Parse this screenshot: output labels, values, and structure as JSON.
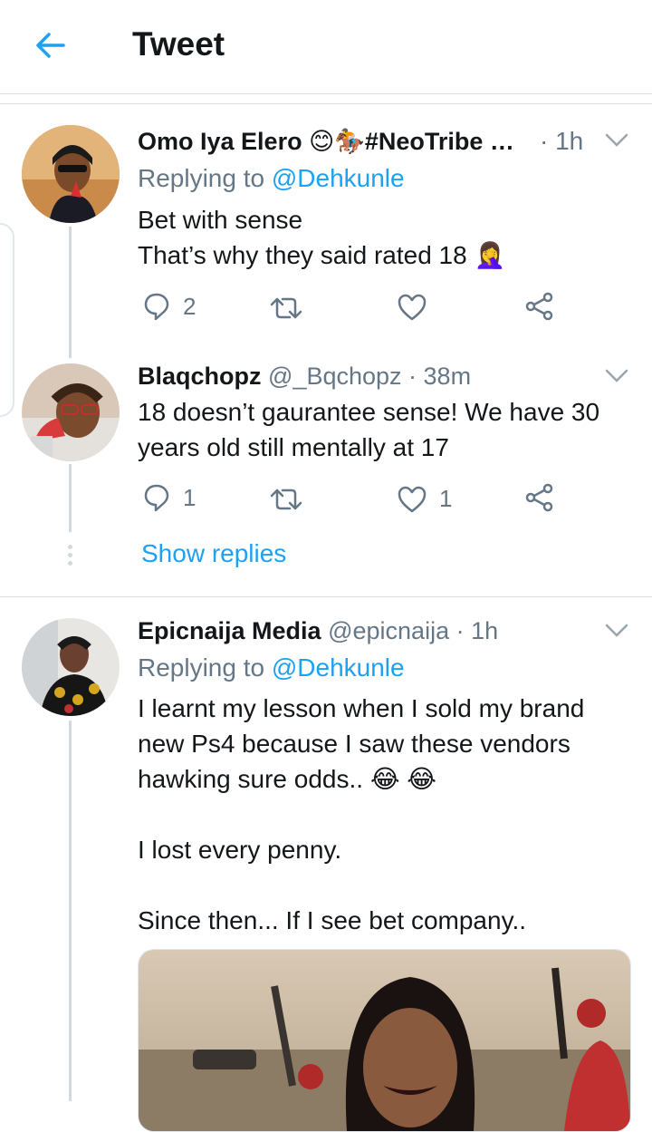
{
  "header": {
    "title": "Tweet"
  },
  "tweets": [
    {
      "name": "Omo Iya Elero 😊🏇#NeoTribe …",
      "handle": "",
      "time": "· 1h",
      "reply_prefix": "Replying to ",
      "reply_handle": "@Dehkunle",
      "text_lines": [
        "Bet with sense",
        "That’s why they said rated 18 🤦‍♀️"
      ],
      "reply_count": "2",
      "retweet_count": "",
      "like_count": ""
    },
    {
      "name": "Blaqchopz",
      "handle": "@_Bqchopz",
      "time": "· 38m",
      "text_lines": [
        "18 doesn’t gaurantee sense! We have 30",
        "years old still mentally at 17"
      ],
      "reply_count": "1",
      "retweet_count": "",
      "like_count": "1"
    },
    {
      "name": "Epicnaija Media",
      "handle": "@epicnaija",
      "time": "· 1h",
      "reply_prefix": "Replying to ",
      "reply_handle": "@Dehkunle",
      "text_lines": [
        "I learnt my lesson when I sold my brand",
        "new Ps4 because I saw these vendors",
        "hawking sure odds.. 😂 😂",
        "",
        "I lost every penny.",
        "",
        "Since then... If I see bet company.."
      ]
    }
  ],
  "show_replies": "Show replies",
  "colors": {
    "accent": "#1da1f2",
    "secondary": "#657786",
    "divider": "#dcdfe2"
  }
}
